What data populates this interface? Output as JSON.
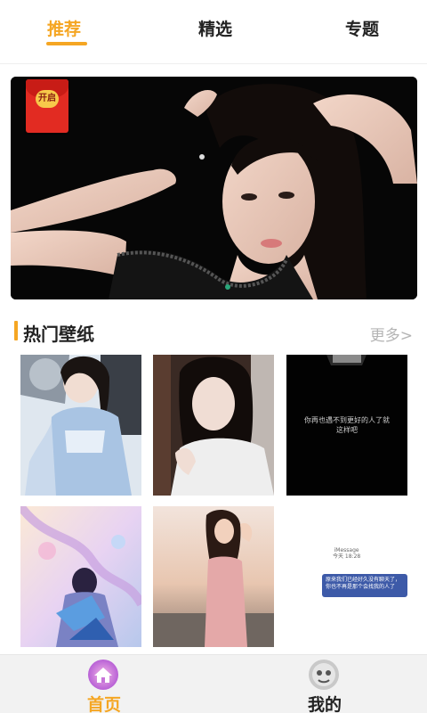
{
  "tabs": {
    "items": [
      {
        "label": "推荐",
        "active": true
      },
      {
        "label": "精选",
        "active": false
      },
      {
        "label": "专题",
        "active": false
      }
    ],
    "active_color": "#f5a623"
  },
  "banner": {
    "badge": {
      "text": "开启",
      "icon": "red-envelope-icon"
    },
    "image": "photo-of-woman-posing"
  },
  "section": {
    "title": "热门壁纸",
    "more_label": "更多>"
  },
  "wallpapers": [
    {
      "image": "girl-in-blue-hanfu-with-fan"
    },
    {
      "image": "girl-in-white-dress"
    },
    {
      "image": "dark-wallpaper-with-text",
      "text": "你再也遇不到更好的人了就这样吧"
    },
    {
      "image": "anime-butterfly-art"
    },
    {
      "image": "girl-at-sunset"
    },
    {
      "image": "imessage-screenshot",
      "label": "iMessage",
      "time": "今天 18:28",
      "bubble": "原来我们已经好久没有聊天了，你也不再是那个会找我的人了"
    }
  ],
  "bottom_nav": {
    "items": [
      {
        "label": "首页",
        "icon": "home-icon",
        "active": true
      },
      {
        "label": "我的",
        "icon": "profile-icon",
        "active": false
      }
    ]
  }
}
